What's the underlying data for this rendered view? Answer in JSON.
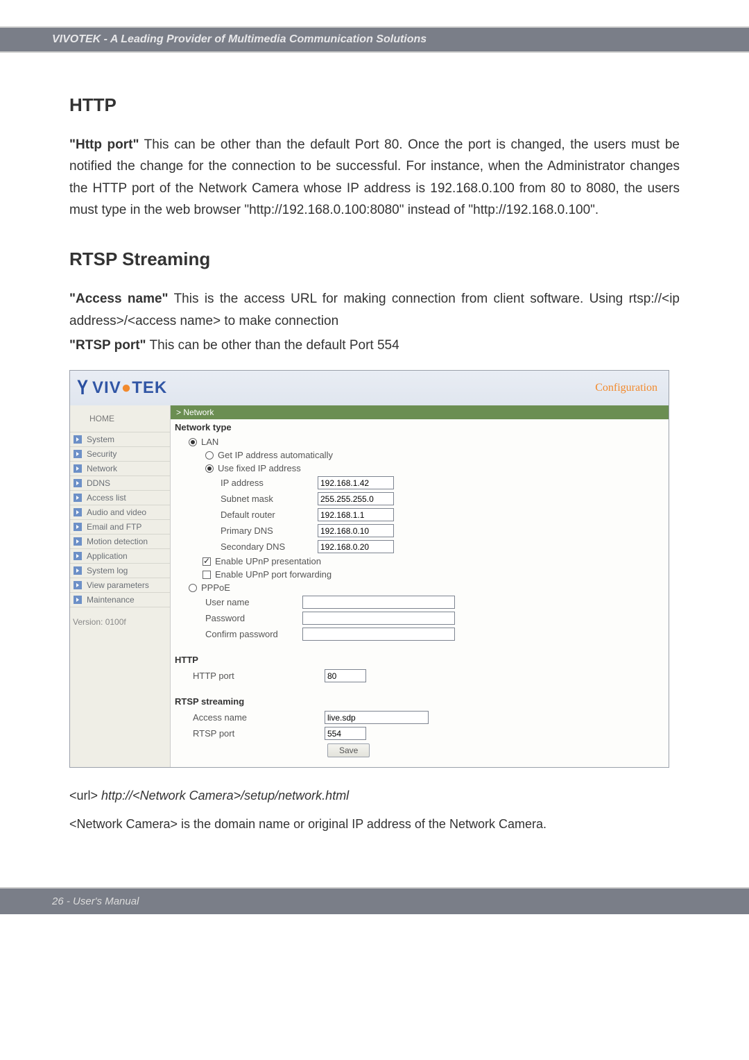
{
  "header": {
    "tagline": "VIVOTEK - A Leading Provider of Multimedia Communication Solutions"
  },
  "section_http": {
    "title": "HTTP",
    "para_prefix": "\"Http port\"",
    "para_rest": " This can be other than the default Port 80. Once the port is changed, the users must be notified the change for the connection to be successful. For instance, when the Administrator changes the HTTP port of the Network Camera whose IP address is 192.168.0.100 from 80 to 8080, the users must type in the web browser \"http://192.168.0.100:8080\" instead of \"http://192.168.0.100\"."
  },
  "section_rtsp": {
    "title": "RTSP Streaming",
    "p1_prefix": "\"Access name\"",
    "p1_rest": " This is the access URL for making connection from client software. Using rtsp://<ip address>/<access name> to make connection",
    "p2_prefix": "\"RTSP port\"",
    "p2_rest": " This can be other than the default Port 554"
  },
  "ui": {
    "logo_text": "VIV   TEK",
    "config_label": "Configuration",
    "sidebar": {
      "home": "HOME",
      "items": [
        {
          "label": "System"
        },
        {
          "label": "Security"
        },
        {
          "label": "Network"
        },
        {
          "label": "DDNS"
        },
        {
          "label": "Access list"
        },
        {
          "label": "Audio and video"
        },
        {
          "label": "Email and FTP"
        },
        {
          "label": "Motion detection"
        },
        {
          "label": "Application"
        },
        {
          "label": "System log"
        },
        {
          "label": "View parameters"
        },
        {
          "label": "Maintenance"
        }
      ],
      "version": "Version: 0100f"
    },
    "crumb": "> Network",
    "network_type_label": "Network type",
    "lan_label": "LAN",
    "get_auto_label": "Get IP address automatically",
    "use_fixed_label": "Use fixed IP address",
    "fields": {
      "ip_label": "IP address",
      "ip_value": "192.168.1.42",
      "subnet_label": "Subnet mask",
      "subnet_value": "255.255.255.0",
      "router_label": "Default router",
      "router_value": "192.168.1.1",
      "pdns_label": "Primary DNS",
      "pdns_value": "192.168.0.10",
      "sdns_label": "Secondary DNS",
      "sdns_value": "192.168.0.20"
    },
    "upnp_pres_label": "Enable UPnP presentation",
    "upnp_fwd_label": "Enable UPnP port forwarding",
    "pppoe_label": "PPPoE",
    "pppoe_user_label": "User name",
    "pppoe_pass_label": "Password",
    "pppoe_conf_label": "Confirm password",
    "http_heading": "HTTP",
    "http_port_label": "HTTP port",
    "http_port_value": "80",
    "rtsp_heading": "RTSP streaming",
    "access_name_label": "Access name",
    "access_name_value": "live.sdp",
    "rtsp_port_label": "RTSP port",
    "rtsp_port_value": "554",
    "save_label": "Save"
  },
  "url_note": {
    "prefix": "<url> ",
    "italic": "http://<Network Camera>/setup/network.html",
    "line2": "<Network Camera> is the domain name or original IP address of the Network Camera."
  },
  "footer": {
    "page": "26 - User's Manual"
  }
}
